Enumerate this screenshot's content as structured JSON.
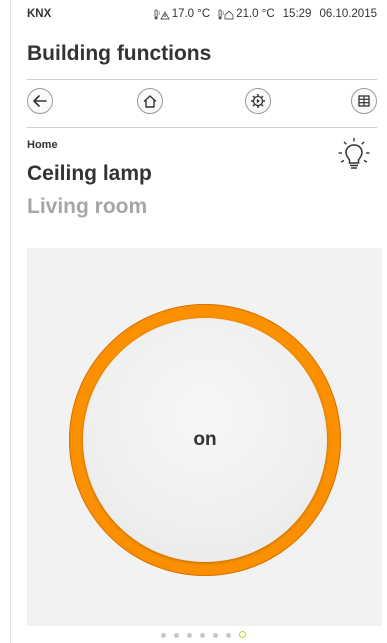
{
  "status": {
    "brand": "KNX",
    "outdoor_temp": "17.0 °C",
    "indoor_temp": "21.0 °C",
    "time": "15:29",
    "date": "06.10.2015"
  },
  "header": {
    "title": "Building functions"
  },
  "toolbar": {
    "buttons": [
      {
        "name": "back-button",
        "icon": "arrow-left-icon"
      },
      {
        "name": "home-button",
        "icon": "house-icon"
      },
      {
        "name": "settings-button",
        "icon": "gear-icon"
      },
      {
        "name": "grid-button",
        "icon": "grid-icon"
      }
    ]
  },
  "breadcrumb": {
    "home": "Home"
  },
  "device": {
    "name": "Ceiling lamp",
    "room": "Living room",
    "icon": "light-bulb-icon",
    "state_label": "on",
    "accent_color": "#fb8f00"
  },
  "pager": {
    "count": 7,
    "active_index": 6,
    "active_color": "#b8d432"
  }
}
